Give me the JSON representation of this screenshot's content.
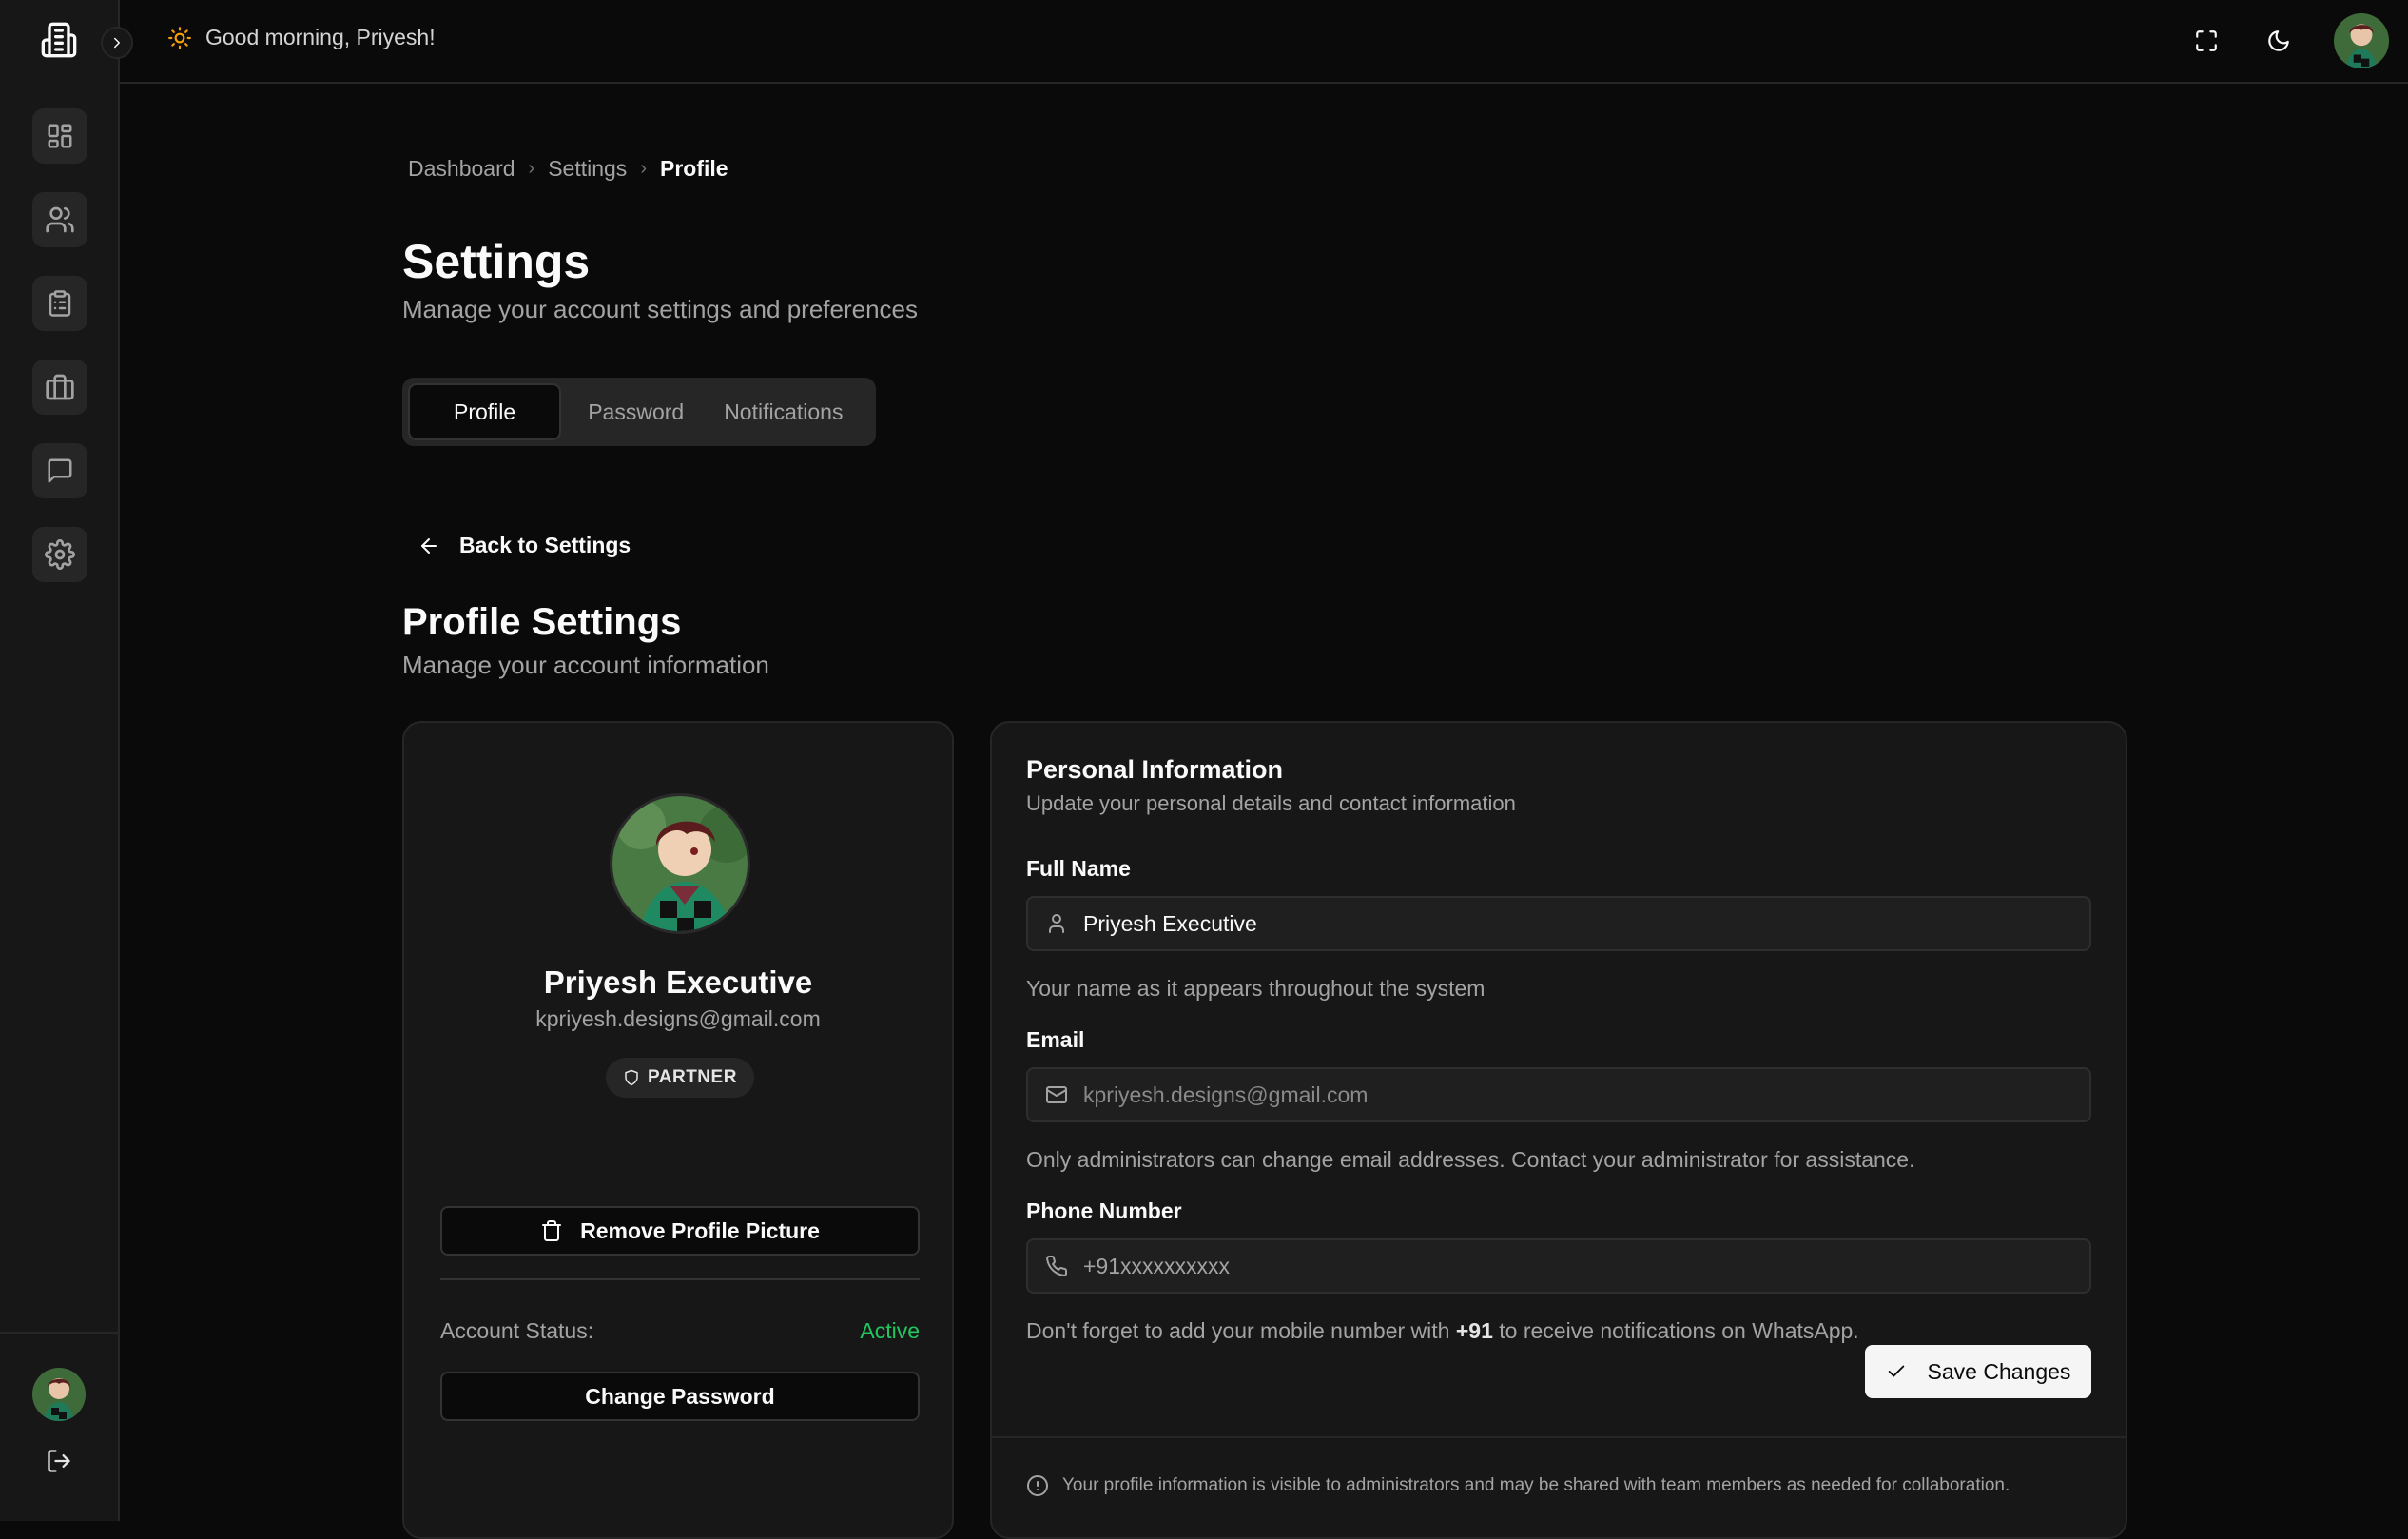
{
  "header": {
    "greeting": "Good morning, Priyesh!"
  },
  "breadcrumb": {
    "items": [
      "Dashboard",
      "Settings",
      "Profile"
    ],
    "separator": "›"
  },
  "page": {
    "title": "Settings",
    "subtitle": "Manage your account settings and preferences"
  },
  "tabs": [
    {
      "label": "Profile",
      "active": true
    },
    {
      "label": "Password",
      "active": false
    },
    {
      "label": "Notifications",
      "active": false
    }
  ],
  "back_label": "Back to Settings",
  "section": {
    "title": "Profile Settings",
    "subtitle": "Manage your account information"
  },
  "profile_card": {
    "name": "Priyesh Executive",
    "email": "kpriyesh.designs@gmail.com",
    "role_badge": "PARTNER",
    "remove_picture_label": "Remove Profile Picture",
    "status_label": "Account Status:",
    "status_value": "Active",
    "change_password_label": "Change Password"
  },
  "personal_info": {
    "title": "Personal Information",
    "subtitle": "Update your personal details and contact information",
    "full_name": {
      "label": "Full Name",
      "value": "Priyesh Executive",
      "hint": "Your name as it appears throughout the system"
    },
    "email": {
      "label": "Email",
      "value": "kpriyesh.designs@gmail.com",
      "hint": "Only administrators can change email addresses. Contact your administrator for assistance."
    },
    "phone": {
      "label": "Phone Number",
      "placeholder": "+91xxxxxxxxxx",
      "hint_prefix": "Don't forget to add your mobile number with ",
      "hint_bold": "+91",
      "hint_suffix": " to receive notifications on WhatsApp."
    },
    "save_label": "Save Changes",
    "footer_note": "Your profile information is visible to administrators and may be shared with team members as needed for collaboration."
  },
  "colors": {
    "background": "#0a0a0a",
    "card": "#171717",
    "active_status": "#22c55e",
    "sun_icon": "#f59e0b",
    "primary_button": "#f5f5f5"
  },
  "icons": {
    "sidebar": [
      "dashboard-icon",
      "users-icon",
      "clipboard-icon",
      "briefcase-icon",
      "message-icon",
      "settings-icon"
    ],
    "header": [
      "fullscreen-icon",
      "moon-icon"
    ]
  }
}
